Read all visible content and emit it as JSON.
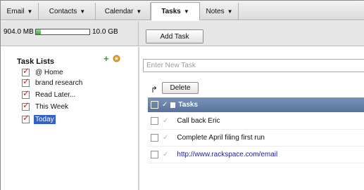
{
  "nav": {
    "tabs": [
      {
        "label": "Email"
      },
      {
        "label": "Contacts"
      },
      {
        "label": "Calendar"
      },
      {
        "label": "Tasks"
      },
      {
        "label": "Notes"
      }
    ],
    "active_tab": "Tasks",
    "dropdown_icon": "caret-down"
  },
  "storage": {
    "used": "904.0 MB",
    "total": "10.0 GB",
    "fraction_used": 0.09,
    "bar_color": "#3aaa3a"
  },
  "toolbar": {
    "add_task_label": "Add Task",
    "delete_label": "Delete"
  },
  "sidebar": {
    "title": "Task Lists",
    "add_icon": "plus-icon",
    "settings_icon": "gear-icon",
    "items": [
      {
        "label": "@ Home"
      },
      {
        "label": "brand research"
      },
      {
        "label": "Read Later..."
      },
      {
        "label": "This Week"
      },
      {
        "label": "Today",
        "selected": true
      }
    ]
  },
  "main": {
    "new_task_placeholder": "Enter New Task",
    "grid_header": "Tasks",
    "tasks": [
      {
        "title": "Call back Eric"
      },
      {
        "title": "Complete April filing first run"
      },
      {
        "title": "http://www.rackspace.com/email",
        "is_link": true
      }
    ]
  },
  "colors": {
    "header_blue": "#58729c",
    "selected_item": "#3161c9",
    "link": "#1a1aa6",
    "list_check": "#d81e1e",
    "add_icon": "#3a9a2c"
  }
}
